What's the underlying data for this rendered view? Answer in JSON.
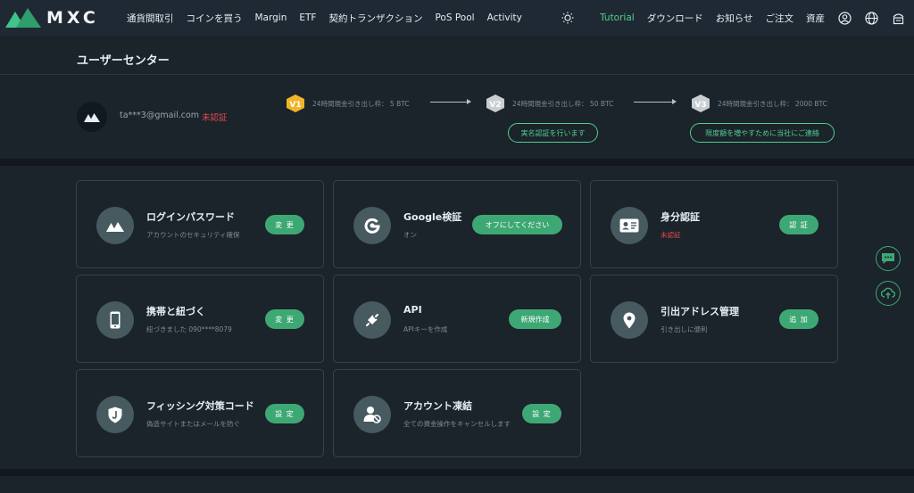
{
  "brand": {
    "name": "MXC",
    "accent": "#3ea874",
    "danger": "#e5484d"
  },
  "nav": {
    "left": [
      "通貨間取引",
      "コインを買う",
      "Margin",
      "ETF",
      "契約トランザクション",
      "PoS Pool",
      "Activity"
    ],
    "tutorial": "Tutorial",
    "download": "ダウンロード",
    "news": "お知らせ",
    "orders": "ご注文",
    "assets": "資産",
    "icons": [
      "sun-icon",
      "user-icon",
      "globe-icon",
      "printer-icon"
    ]
  },
  "user_center": {
    "title": "ユーザーセンター",
    "email": "ta***3@gmail.com",
    "status": "未認証"
  },
  "levels": [
    {
      "badge": "V1",
      "limit": "24時間現金引き出し枠： 5 BTC",
      "color": "#f0b429"
    },
    {
      "badge": "V2",
      "limit": "24時間現金引き出し枠： 50 BTC",
      "color": "#c9ced3"
    },
    {
      "badge": "V3",
      "limit": "24時間現金引き出し枠： 2000 BTC",
      "color": "#c9ced3"
    }
  ],
  "actions": {
    "verify": "実名認証を行います",
    "contact": "限度額を増やすために当社にご連絡"
  },
  "cards": [
    {
      "icon": "mxc-logo-icon",
      "title": "ログインパスワード",
      "desc": "アカウントのセキュリティ確保",
      "button": "変 更"
    },
    {
      "icon": "google-icon",
      "title": "Google検証",
      "desc": "オン",
      "button": "オフにしてください"
    },
    {
      "icon": "id-card-icon",
      "title": "身分認証",
      "desc": "未認証",
      "button": "認 証"
    },
    {
      "icon": "mobile-phone-icon",
      "title": "携帯と紐づく",
      "desc": "紐づきました 090****8079",
      "button": "変 更"
    },
    {
      "icon": "plug-icon",
      "title": "API",
      "desc": "APIキーを作成",
      "button": "新規作成"
    },
    {
      "icon": "location-pin-icon",
      "title": "引出アドレス管理",
      "desc": "引き出しに便利",
      "button": "追 加"
    },
    {
      "icon": "shield-icon",
      "title": "フィッシング対策コード",
      "desc": "偽造サイトまたはメールを防ぐ",
      "button": "設 定"
    },
    {
      "icon": "user-block-icon",
      "title": "アカウント凍結",
      "desc": "全ての資金操作をキャンセルします",
      "button": "設 定"
    }
  ],
  "floating": [
    "chat-icon",
    "cloud-upload-icon"
  ]
}
